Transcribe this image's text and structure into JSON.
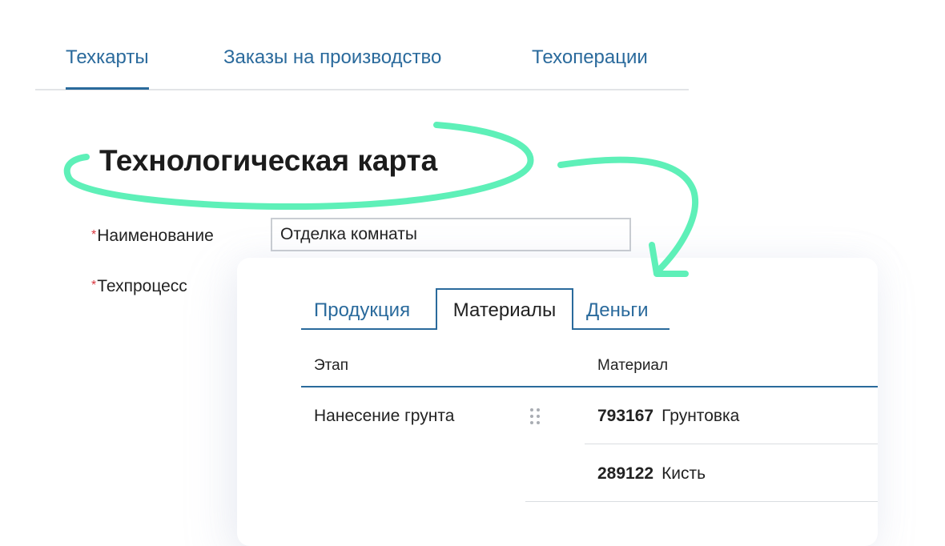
{
  "nav": {
    "tabs": [
      {
        "label": "Техкарты",
        "active": true
      },
      {
        "label": "Заказы на производство",
        "active": false
      },
      {
        "label": "Техоперации",
        "active": false
      }
    ]
  },
  "page": {
    "title": "Технологическая карта"
  },
  "form": {
    "required_mark": "*",
    "name_label": "Наименование",
    "name_value": "Отделка комнаты",
    "process_label": "Техпроцесс"
  },
  "card": {
    "tabs": [
      {
        "label": "Продукция",
        "active": false
      },
      {
        "label": "Материалы",
        "active": true
      },
      {
        "label": "Деньги",
        "active": false
      }
    ],
    "columns": {
      "stage": "Этап",
      "material": "Материал"
    },
    "rows": [
      {
        "stage": "Нанесение грунта",
        "materials": [
          {
            "code": "793167",
            "name": "Грунтовка"
          },
          {
            "code": "289122",
            "name": "Кисть"
          }
        ]
      }
    ]
  },
  "colors": {
    "accent": "#2a6a9c",
    "marker": "#5ef0b8",
    "required": "#d9363e"
  }
}
